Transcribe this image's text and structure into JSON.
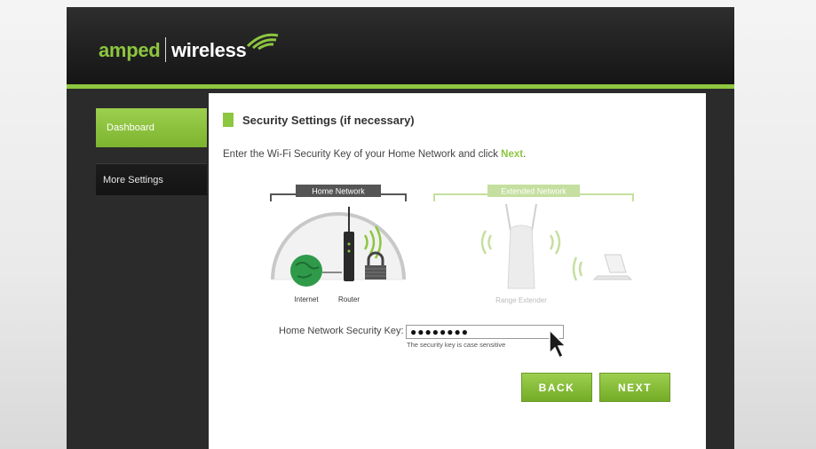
{
  "logo": {
    "amped": "amped",
    "wireless": "wireless"
  },
  "sidebar": {
    "items": [
      {
        "label": "Dashboard"
      },
      {
        "label": "More Settings"
      }
    ]
  },
  "main": {
    "title": "Security Settings (if necessary)",
    "instruction_pre": "Enter the Wi-Fi Security Key of your Home Network and click ",
    "instruction_next": "Next",
    "instruction_post": "."
  },
  "diagram": {
    "home_network_label": "Home Network",
    "extended_network_label": "Extended Network",
    "internet_label": "Internet",
    "router_label": "Router",
    "range_extender_label": "Range Extender"
  },
  "form": {
    "key_label": "Home Network Security Key:",
    "key_value": "●●●●●●●●",
    "key_hint": "The security key is case sensitive"
  },
  "buttons": {
    "back": "BACK",
    "next": "NEXT"
  },
  "colors": {
    "accent": "#8dc63f",
    "header": "#151515",
    "sidebar": "#2b2b2b"
  }
}
